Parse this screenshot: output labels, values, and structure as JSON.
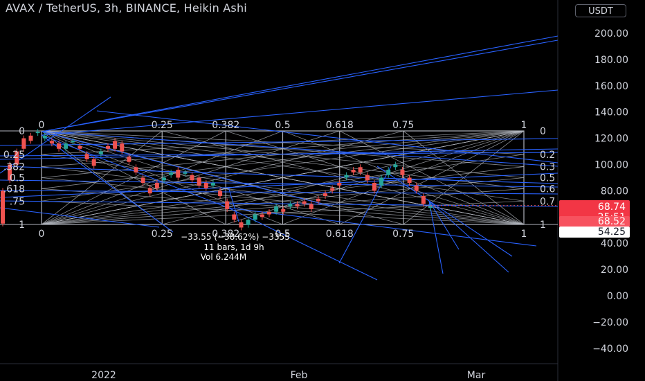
{
  "header": {
    "title": "AVAX / TetherUS, 3h, BINANCE, Heikin Ashi",
    "unit_button": "USDT"
  },
  "colors": {
    "background": "#000000",
    "up": "#26a69a",
    "down": "#ef5350",
    "drawing_lines": "#2962ff",
    "fib_grid": "#b2b5be",
    "price_badge": "#f23645"
  },
  "chart_data": {
    "type": "candlestick",
    "title": "AVAX / TetherUS, 3h, BINANCE, Heikin Ashi",
    "y_axis_labels": [
      "200.00",
      "180.00",
      "160.00",
      "140.00",
      "120.00",
      "100.00",
      "80.00",
      "40.00",
      "20.00",
      "0.00",
      "−20.00",
      "−40.00"
    ],
    "x_axis_labels": [
      "2022",
      "Feb",
      "Mar"
    ],
    "ylim": [
      -50,
      210
    ],
    "price_badges": {
      "last_price": "68.74",
      "countdown": "25:51",
      "ma_value": "68.52",
      "level": "54.25"
    },
    "fib_levels_top": [
      "0",
      "0.25",
      "0.382",
      "0.5",
      "0.618",
      "0.75",
      "1"
    ],
    "fib_levels_bottom": [
      "0",
      "0.25",
      "0.382",
      "0.5",
      "0.618",
      "0.75",
      "1"
    ],
    "fib_side_left": [
      "0",
      "0.25",
      ".382",
      "0.5",
      ".618",
      ".75",
      "1"
    ],
    "fib_side_right": [
      "0",
      "0.2",
      "0.3",
      "0.5",
      "0.6",
      "0.7",
      "1"
    ],
    "fib_price_range": [
      51,
      126
    ],
    "measure_tooltip": {
      "line1": "−33.55 (−38.62%) −3355",
      "line2": "11 bars, 1d 9h",
      "line3": "Vol 6.244M"
    },
    "price_path": [
      [
        80,
        55
      ],
      [
        100,
        88
      ],
      [
        110,
        100
      ],
      [
        120,
        112
      ],
      [
        122,
        118
      ],
      [
        124,
        125
      ],
      [
        120,
        122
      ],
      [
        118,
        116
      ],
      [
        116,
        112
      ],
      [
        112,
        116
      ],
      [
        117,
        118
      ],
      [
        114,
        112
      ],
      [
        108,
        104
      ],
      [
        104,
        99
      ],
      [
        108,
        110
      ],
      [
        114,
        112
      ],
      [
        118,
        112
      ],
      [
        116,
        110
      ],
      [
        106,
        102
      ],
      [
        98,
        94
      ],
      [
        90,
        86
      ],
      [
        82,
        78
      ],
      [
        86,
        82
      ],
      [
        88,
        90
      ],
      [
        92,
        94
      ],
      [
        96,
        90
      ],
      [
        94,
        94
      ],
      [
        92,
        88
      ],
      [
        90,
        84
      ],
      [
        86,
        82
      ],
      [
        84,
        86
      ],
      [
        80,
        76
      ],
      [
        72,
        66
      ],
      [
        62,
        58
      ],
      [
        56,
        52
      ],
      [
        54,
        58
      ],
      [
        58,
        62
      ],
      [
        62,
        60
      ],
      [
        64,
        62
      ],
      [
        64,
        68
      ],
      [
        66,
        64
      ],
      [
        68,
        70
      ],
      [
        70,
        68
      ],
      [
        72,
        70
      ],
      [
        70,
        66
      ],
      [
        74,
        72
      ],
      [
        78,
        76
      ],
      [
        82,
        80
      ],
      [
        86,
        84
      ],
      [
        90,
        92
      ],
      [
        96,
        94
      ],
      [
        98,
        94
      ],
      [
        92,
        88
      ],
      [
        86,
        80
      ],
      [
        84,
        90
      ],
      [
        92,
        96
      ],
      [
        98,
        100
      ],
      [
        96,
        92
      ],
      [
        90,
        86
      ],
      [
        84,
        80
      ],
      [
        76,
        70
      ],
      [
        68,
        68
      ]
    ]
  },
  "drawings": {
    "fib_top_label_y": "0"
  }
}
